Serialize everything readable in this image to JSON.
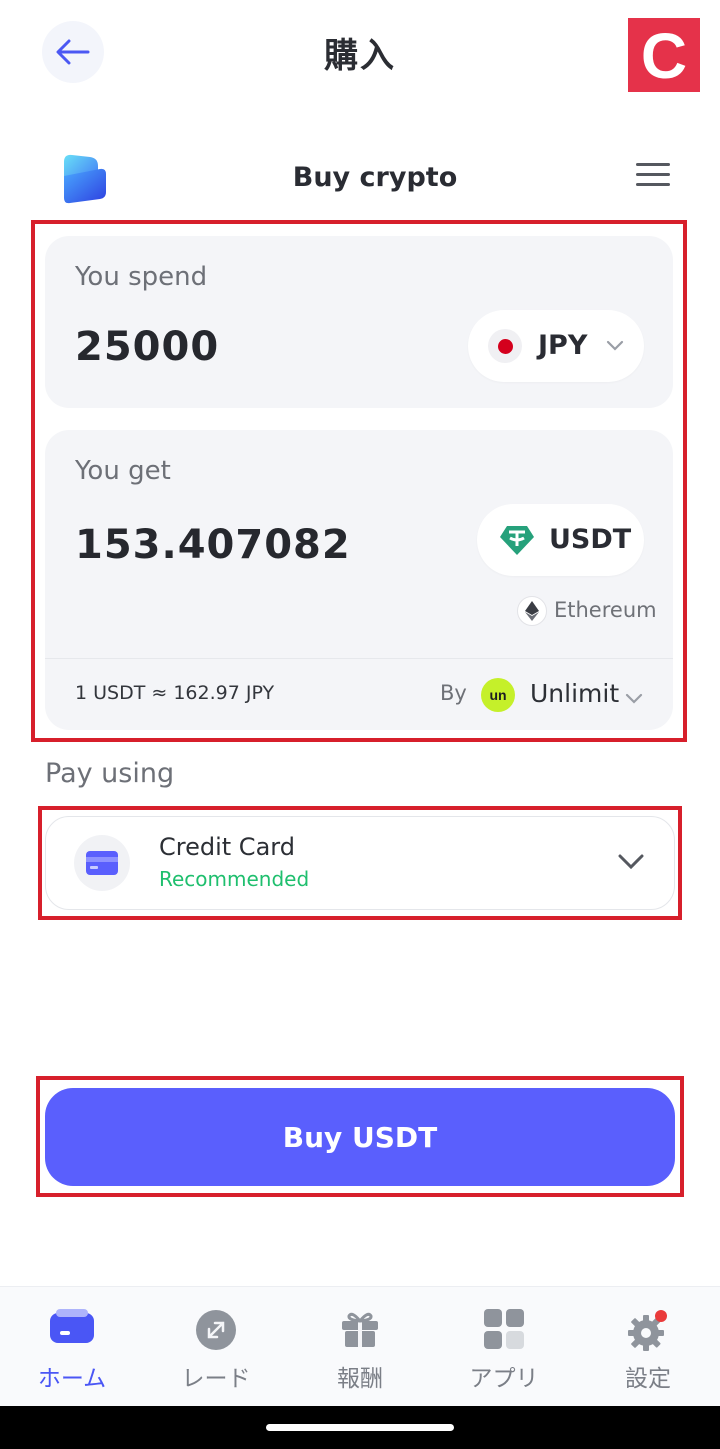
{
  "header": {
    "title": "購入",
    "brand_letter": "C",
    "brand_color": "#e5324a"
  },
  "widget": {
    "title": "Buy crypto",
    "spend": {
      "label": "You spend",
      "amount": "25000",
      "currency": "JPY",
      "currency_icon": "japan-flag-icon"
    },
    "get": {
      "label": "You get",
      "amount": "153.407082",
      "currency": "USDT",
      "currency_icon": "tether-icon",
      "network": "Ethereum",
      "network_icon": "ethereum-icon"
    },
    "rate": "1 USDT ≈ 162.97 JPY",
    "by_label": "By",
    "provider": "Unlimit",
    "provider_icon": "unlimit-logo-icon"
  },
  "payment": {
    "label": "Pay using",
    "method": "Credit Card",
    "method_tag": "Recommended",
    "method_icon": "credit-card-icon"
  },
  "buy_button": {
    "label": "Buy USDT",
    "color": "#5a5ffd"
  },
  "bottom_nav": {
    "items": [
      {
        "label": "ホーム",
        "icon": "wallet-icon",
        "active": true
      },
      {
        "label": "レード",
        "icon": "trade-icon",
        "active": false
      },
      {
        "label": "報酬",
        "icon": "gift-icon",
        "active": false
      },
      {
        "label": "アプリ",
        "icon": "apps-grid-icon",
        "active": false
      },
      {
        "label": "設定",
        "icon": "gear-icon",
        "active": false
      }
    ]
  },
  "colors": {
    "accent": "#5a5ffd",
    "highlight_border": "#d71f2b",
    "recommended": "#1fbf6e",
    "active_nav": "#4a56f5"
  }
}
